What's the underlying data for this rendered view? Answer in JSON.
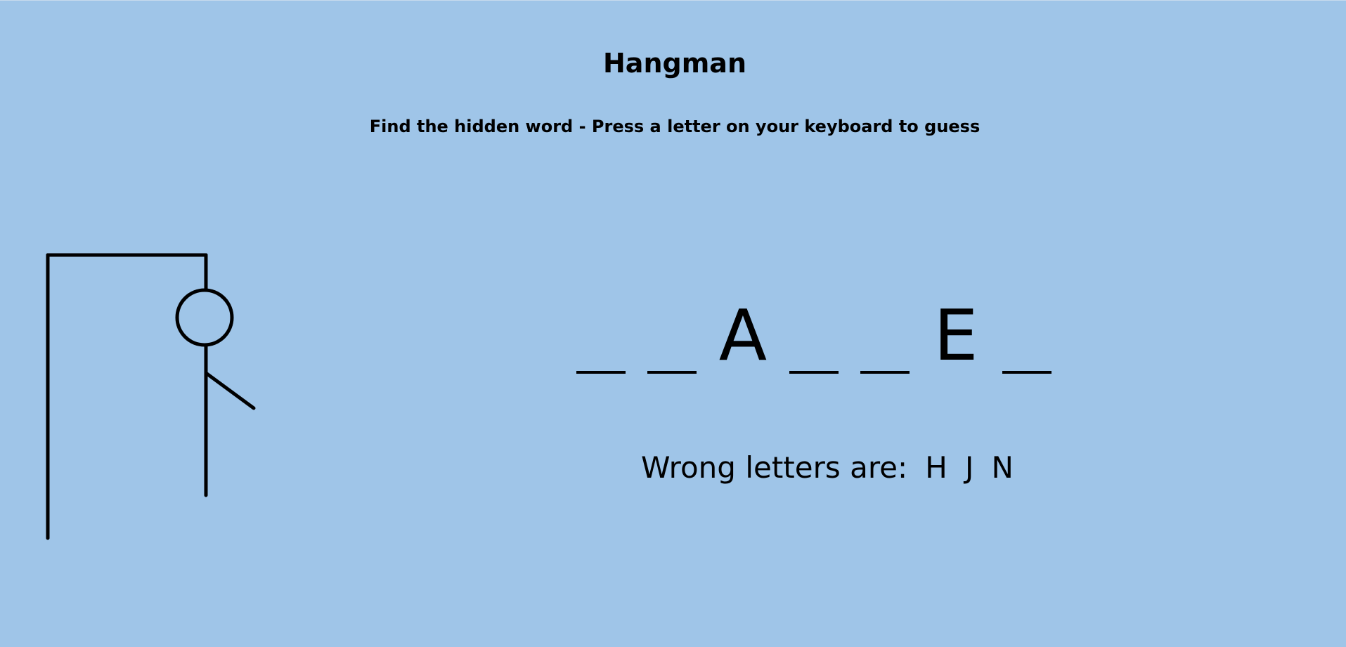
{
  "header": {
    "title": "Hangman",
    "subtitle": "Find the hidden word - Press a letter on your keyboard to guess"
  },
  "word": {
    "letters": [
      "",
      "",
      "A",
      "",
      "",
      "E",
      ""
    ]
  },
  "wrong_letters": {
    "label": "Wrong letters are:",
    "letters": [
      "H",
      "J",
      "N"
    ]
  },
  "hangman": {
    "parts_shown": [
      "head",
      "body",
      "right-arm"
    ]
  },
  "colors": {
    "background": "#9fc5e8",
    "stroke": "#000000"
  }
}
